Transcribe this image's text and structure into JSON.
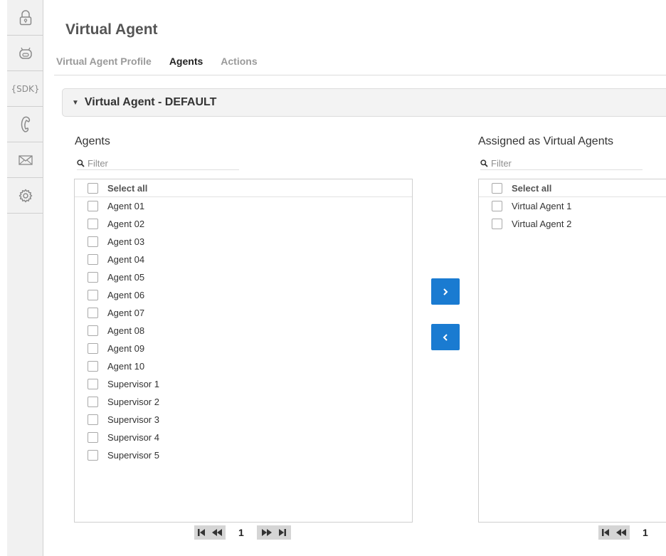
{
  "rail": {
    "items": [
      {
        "icon": "lock-icon"
      },
      {
        "icon": "robot-icon"
      },
      {
        "icon": "sdk-icon",
        "text": "{SDK}"
      },
      {
        "icon": "phone-icon"
      },
      {
        "icon": "mail-icon"
      },
      {
        "icon": "gear-icon"
      }
    ]
  },
  "header": {
    "title": "Virtual Agent",
    "tabs": [
      {
        "label": "Virtual Agent Profile",
        "active": false
      },
      {
        "label": "Agents",
        "active": true
      },
      {
        "label": "Actions",
        "active": false
      }
    ]
  },
  "section": {
    "title": "Virtual Agent - DEFAULT"
  },
  "left_panel": {
    "title": "Agents",
    "filter_placeholder": "Filter",
    "select_all": "Select all",
    "items": [
      "Agent 01",
      "Agent 02",
      "Agent 03",
      "Agent 04",
      "Agent 05",
      "Agent 06",
      "Agent 07",
      "Agent 08",
      "Agent 09",
      "Agent 10",
      "Supervisor 1",
      "Supervisor 2",
      "Supervisor 3",
      "Supervisor 4",
      "Supervisor 5"
    ],
    "page": "1"
  },
  "right_panel": {
    "title": "Assigned as Virtual Agents",
    "filter_placeholder": "Filter",
    "select_all": "Select all",
    "items": [
      "Virtual Agent 1",
      "Virtual Agent 2"
    ],
    "page": "1"
  },
  "colors": {
    "accent": "#1a7bd1",
    "rail_bg": "#f1f1f1",
    "pager_bg": "#d5d5d5"
  }
}
